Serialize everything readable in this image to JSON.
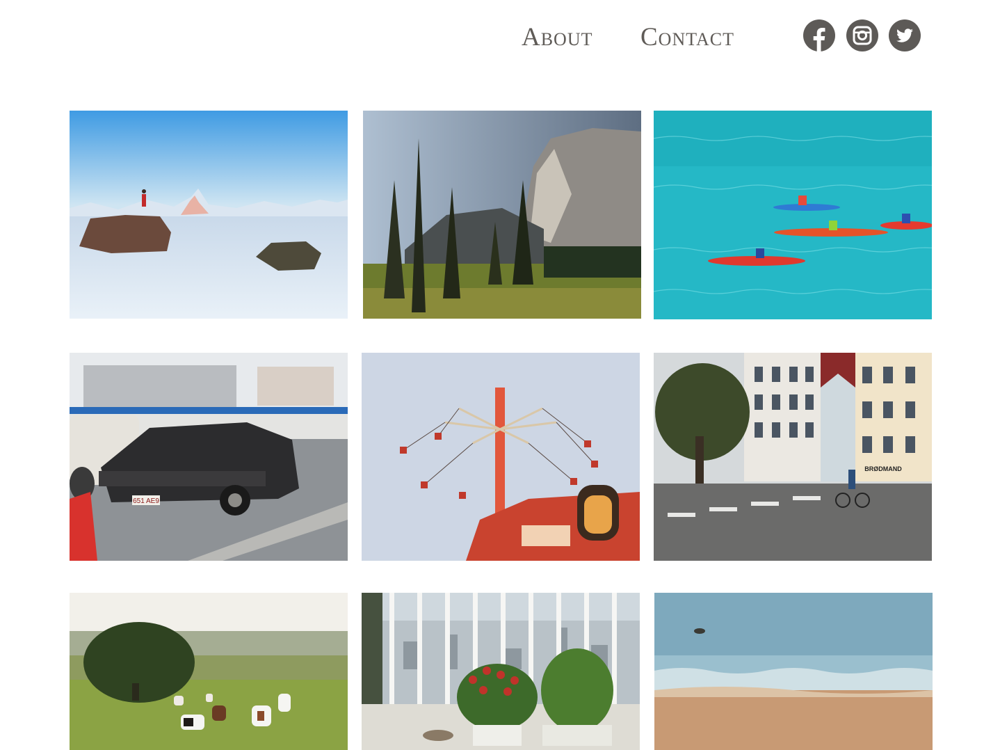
{
  "nav": {
    "links": [
      {
        "label": "About"
      },
      {
        "label": "Contact"
      }
    ],
    "social": [
      {
        "icon": "facebook-icon"
      },
      {
        "icon": "instagram-icon"
      },
      {
        "icon": "twitter-icon"
      }
    ],
    "icon_color": "#5d5a57",
    "text_color": "#5f5b57"
  },
  "gallery": {
    "photos": [
      {
        "subject": "mountaineer-on-snowy-rock"
      },
      {
        "subject": "cliff-and-pine-forest-meadow"
      },
      {
        "subject": "kayakers-on-turquoise-water"
      },
      {
        "subject": "vintage-black-coupe-parked",
        "plate_text": "651 AE9"
      },
      {
        "subject": "swing-carousel-ride"
      },
      {
        "subject": "city-street-with-cyclists",
        "sign_text": "BRØDMAND"
      },
      {
        "subject": "cows-on-green-hill"
      },
      {
        "subject": "balcony-flowers-over-city"
      },
      {
        "subject": "sandy-beach-and-sea"
      }
    ]
  }
}
